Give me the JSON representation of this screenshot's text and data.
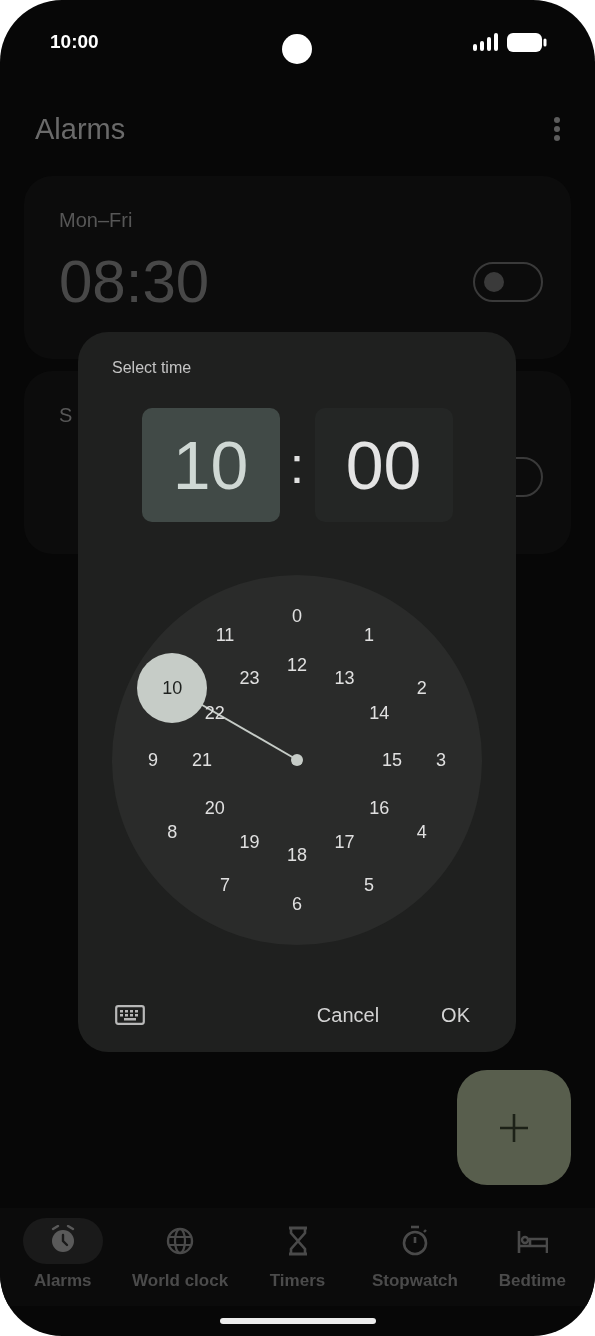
{
  "status_bar": {
    "time": "10:00"
  },
  "app_bar": {
    "title": "Alarms"
  },
  "alarms": [
    {
      "label": "Mon–Fri",
      "time": "08:30",
      "on": false
    },
    {
      "label": "S",
      "on": false
    }
  ],
  "dialog": {
    "title": "Select time",
    "hour": {
      "text": "10",
      "selected": true
    },
    "separator": ":",
    "minute": {
      "text": "00",
      "selected": false
    },
    "dial": {
      "hours": [
        {
          "label": "0",
          "selected": false
        },
        {
          "label": "1",
          "selected": false
        },
        {
          "label": "2",
          "selected": false
        },
        {
          "label": "3",
          "selected": false
        },
        {
          "label": "4",
          "selected": false
        },
        {
          "label": "5",
          "selected": false
        },
        {
          "label": "6",
          "selected": false
        },
        {
          "label": "7",
          "selected": false
        },
        {
          "label": "8",
          "selected": false
        },
        {
          "label": "9",
          "selected": false
        },
        {
          "label": "10",
          "selected": true
        },
        {
          "label": "11",
          "selected": false
        },
        {
          "label": "12",
          "selected": false
        },
        {
          "label": "13",
          "selected": false
        },
        {
          "label": "14",
          "selected": false
        },
        {
          "label": "15",
          "selected": false
        },
        {
          "label": "16",
          "selected": false
        },
        {
          "label": "17",
          "selected": false
        },
        {
          "label": "18",
          "selected": false
        },
        {
          "label": "19",
          "selected": false
        },
        {
          "label": "20",
          "selected": false
        },
        {
          "label": "21",
          "selected": false
        },
        {
          "label": "22",
          "selected": false
        },
        {
          "label": "23",
          "selected": false
        }
      ]
    },
    "buttons": [
      "Cancel",
      "OK"
    ]
  },
  "nav": [
    {
      "label": "Alarms",
      "selected": true
    },
    {
      "label": "World clock",
      "selected": false
    },
    {
      "label": "Timers",
      "selected": false
    },
    {
      "label": "Stopwatch",
      "selected": false
    },
    {
      "label": "Bedtime",
      "selected": false
    }
  ]
}
